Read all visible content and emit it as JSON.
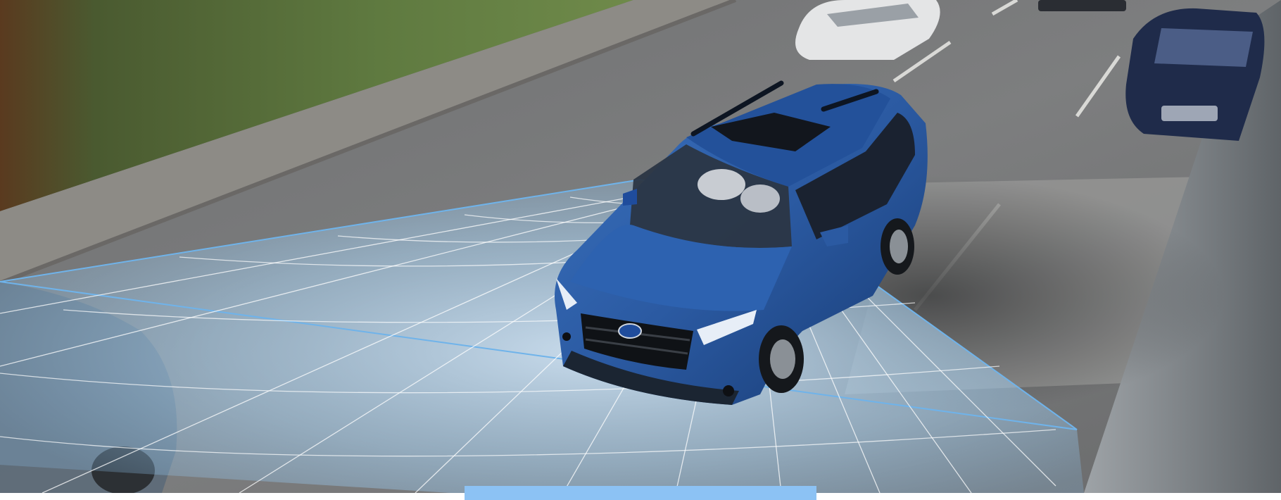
{
  "scene": {
    "subject": "blue-suv",
    "sensor_overlay": "driver-assist-camera-field-of-view",
    "vehicle_badge": "subaru-emblem"
  },
  "colors": {
    "road": "#7b7c7d",
    "road_light": "#9a9a99",
    "grass": "#4f6a3a",
    "curb": "#8d8b86",
    "suv_body": "#2f5fa7",
    "suv_dark": "#1c3f7a",
    "sensor_fill": "#a9d2f2",
    "sensor_line": "#ffffff",
    "sensor_edge": "#6fb3ea",
    "wall": "#8a8f93",
    "accent_tab": "#8cc2f4"
  }
}
